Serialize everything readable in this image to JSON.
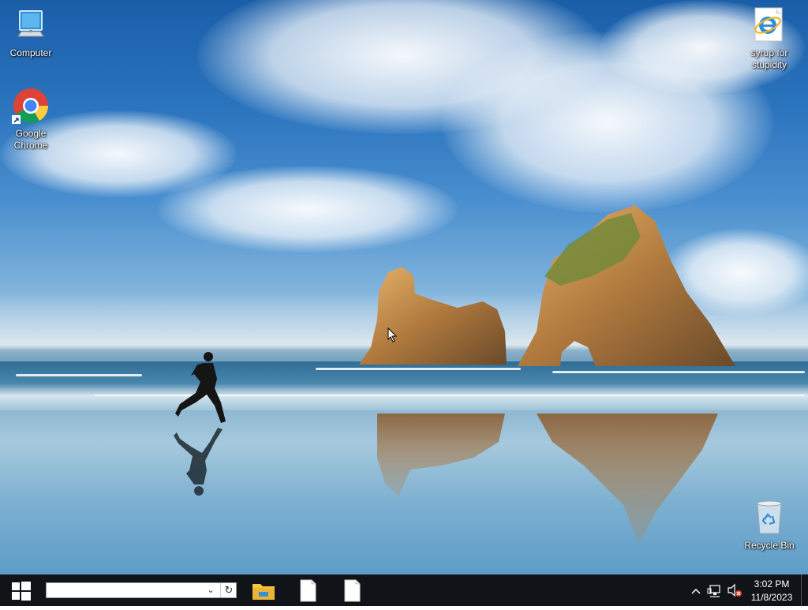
{
  "desktop": {
    "icons": [
      {
        "label": "Computer",
        "icon": "computer-icon"
      },
      {
        "label": "Google Chrome",
        "icon": "chrome-icon"
      },
      {
        "label": "syrup for stupidity",
        "icon": "internet-explorer-icon"
      },
      {
        "label": "Recycle Bin",
        "icon": "recycle-bin-icon"
      }
    ]
  },
  "taskbar": {
    "search": {
      "value": "",
      "placeholder": ""
    },
    "pinned": [
      {
        "icon": "file-explorer-icon"
      },
      {
        "icon": "document-icon"
      },
      {
        "icon": "document-icon"
      }
    ],
    "tray": {
      "time": "3:02 PM",
      "date": "11/8/2023",
      "icons": [
        "chevron-up-icon",
        "network-icon",
        "speaker-muted-icon"
      ]
    }
  },
  "colors": {
    "taskbar": "#101418",
    "start_accent": "#ffffff",
    "folder_yellow": "#f4c542"
  }
}
